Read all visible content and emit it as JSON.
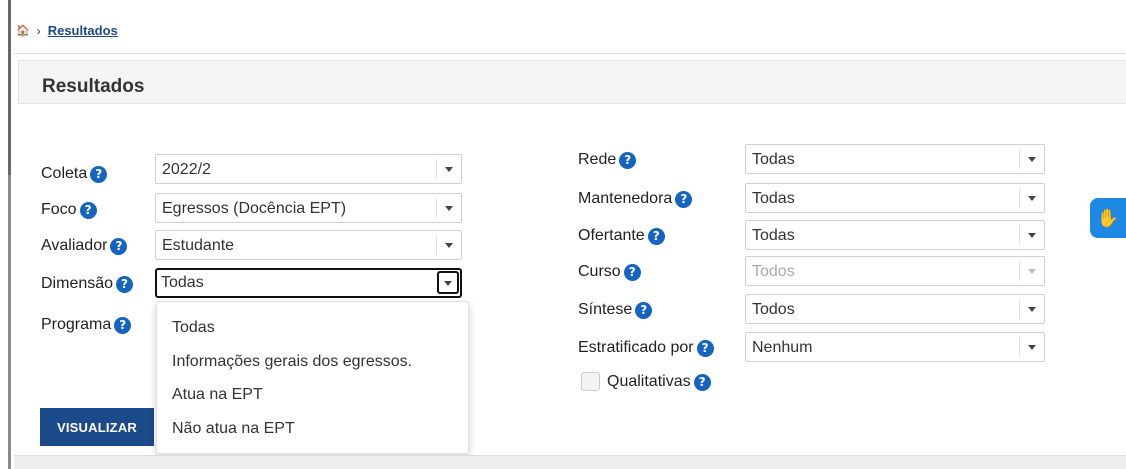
{
  "breadcrumb": {
    "current": "Resultados"
  },
  "page": {
    "title": "Resultados"
  },
  "filters_left": [
    {
      "label": "Coleta",
      "value": "2022/2"
    },
    {
      "label": "Foco",
      "value": "Egressos (Docência EPT)"
    },
    {
      "label": "Avaliador",
      "value": "Estudante"
    },
    {
      "label": "Dimensão",
      "value": "Todas",
      "state": "open"
    },
    {
      "label": "Programa"
    }
  ],
  "filters_right": [
    {
      "label": "Rede",
      "value": "Todas"
    },
    {
      "label": "Mantenedora",
      "value": "Todas"
    },
    {
      "label": "Ofertante",
      "value": "Todas"
    },
    {
      "label": "Curso",
      "value": "Todos",
      "state": "disabled"
    },
    {
      "label": "Síntese",
      "value": "Todos"
    },
    {
      "label": "Estratificado por",
      "value": "Nenhum"
    }
  ],
  "dimensao_dropdown": {
    "options": [
      "Todas",
      "Informações gerais dos egressos.",
      "Atua na EPT",
      "Não atua na EPT"
    ]
  },
  "checkbox": {
    "label": "Qualitativas",
    "checked": false
  },
  "buttons": {
    "visualizar": "VISUALIZAR"
  },
  "icons": {
    "home": "home-icon",
    "breadcrumb_separator": "chevron-right-icon",
    "help": "question-circle-icon",
    "select_arrow": "caret-down-icon",
    "accessibility": "sign-language-hands-icon"
  },
  "glyphs": {
    "home": "🏠",
    "separator": "›",
    "help": "?",
    "hands": "✋"
  },
  "colors": {
    "accent": "#1a4a8a",
    "help_icon": "#1565c0",
    "accessibility_widget": "#1e88e5"
  }
}
